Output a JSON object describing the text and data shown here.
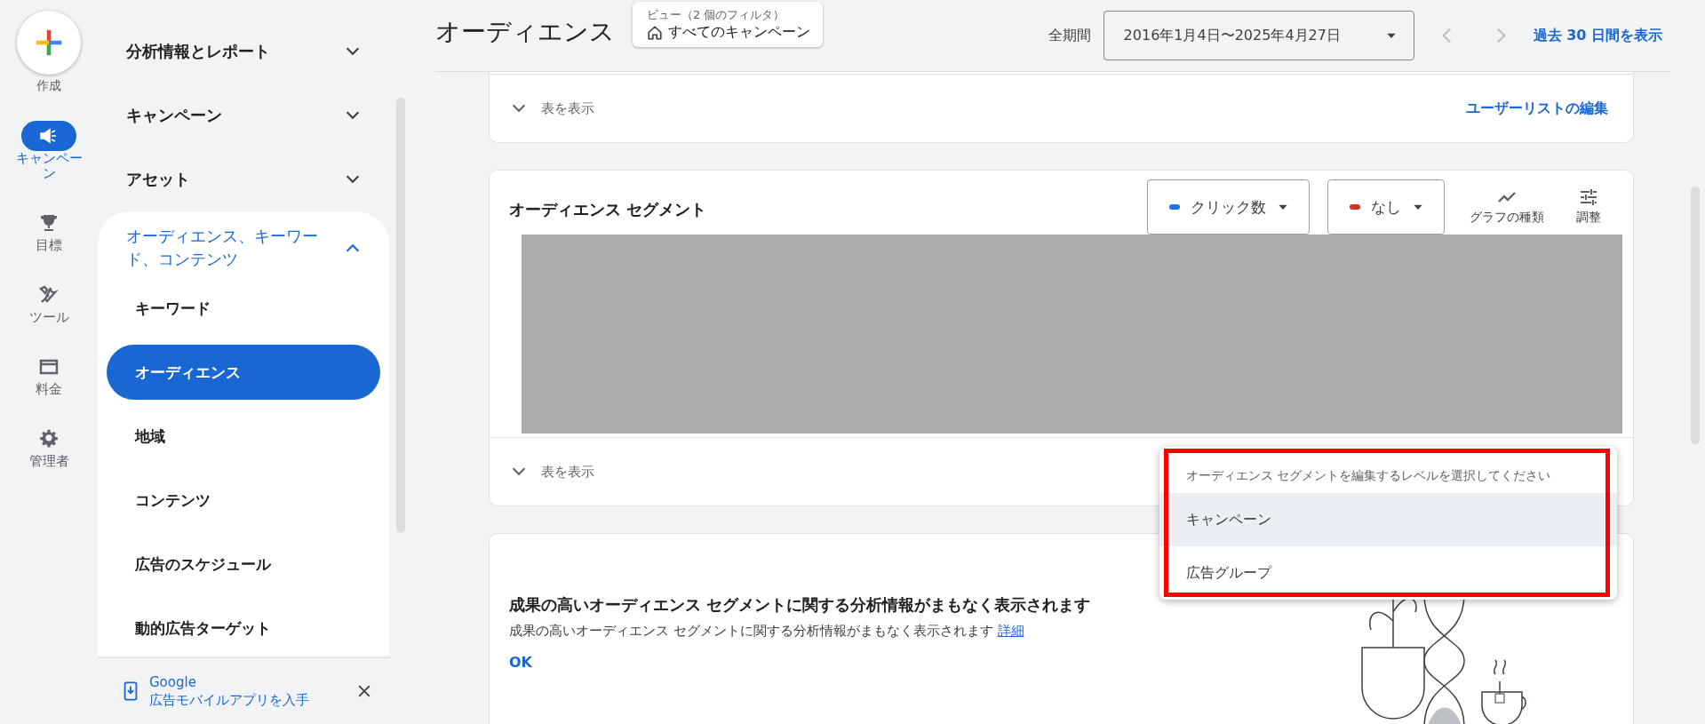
{
  "rail": {
    "create_label": "作成",
    "items": [
      {
        "label": "キャンペーン",
        "selected": true
      },
      {
        "label": "目標",
        "selected": false
      },
      {
        "label": "ツール",
        "selected": false
      },
      {
        "label": "料金",
        "selected": false
      },
      {
        "label": "管理者",
        "selected": false
      }
    ]
  },
  "sidebar": {
    "sections": [
      {
        "label": "分析情報とレポート",
        "expanded": false
      },
      {
        "label": "キャンペーン",
        "expanded": false
      },
      {
        "label": "アセット",
        "expanded": false
      },
      {
        "label": "オーディエンス、キーワード、コンテンツ",
        "expanded": true,
        "children": [
          {
            "label": "キーワード",
            "selected": false
          },
          {
            "label": "オーディエンス",
            "selected": true
          },
          {
            "label": "地域",
            "selected": false
          },
          {
            "label": "コンテンツ",
            "selected": false
          },
          {
            "label": "広告のスケジュール",
            "selected": false
          },
          {
            "label": "動的広告ターゲット",
            "selected": false
          }
        ]
      }
    ],
    "promo": {
      "line1": "Google",
      "line2": "広告モバイルアプリを入手"
    }
  },
  "header": {
    "title": "オーディエンス",
    "view": {
      "caption": "ビュー（2 個のフィルタ）",
      "value": "すべてのキャンペーン"
    },
    "period_label": "全期間",
    "date_range": "2016年1月4日〜2025年4月27日",
    "last_30_link": "過去 30 日間を表示"
  },
  "cards": [
    {
      "kind": "footer",
      "toggle": "表を表示",
      "link": "ユーザーリストの編集"
    },
    {
      "kind": "chart",
      "title": "オーディエンス セグメント",
      "metrics": [
        {
          "label": "クリック数",
          "color": "#1a73e8"
        },
        {
          "label": "なし",
          "color": "#d93025"
        }
      ],
      "tools": [
        "グラフの種類",
        "調整"
      ],
      "toggle": "表を表示"
    },
    {
      "kind": "insight",
      "heading": "成果の高いオーディエンス セグメントに関する分析情報がまもなく表示されます",
      "text": "成果の高いオーディエンス セグメントに関する分析情報がまもなく表示されます",
      "link": "詳細",
      "button": "OK"
    }
  ],
  "popup": {
    "title": "オーディエンス セグメントを編集するレベルを選択してください",
    "items": [
      {
        "label": "キャンペーン",
        "selected": true
      },
      {
        "label": "広告グループ",
        "selected": false
      }
    ]
  }
}
